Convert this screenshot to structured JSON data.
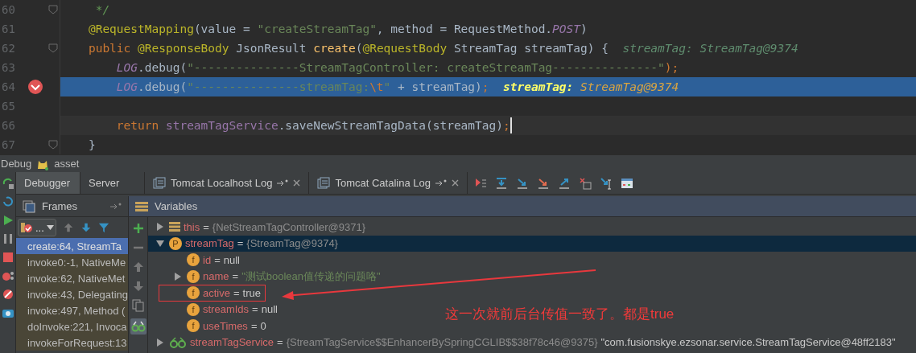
{
  "editor": {
    "lines": [
      {
        "number": "60",
        "fold": true,
        "breakpoint": false,
        "current": false,
        "caret": false,
        "tokens": [
          {
            "text": "     */",
            "kind": "comment"
          }
        ]
      },
      {
        "number": "61",
        "fold": false,
        "breakpoint": false,
        "current": false,
        "caret": false,
        "tokens": [
          {
            "text": "    @RequestMapping",
            "kind": "annotation"
          },
          {
            "text": "(value = ",
            "kind": "plain"
          },
          {
            "text": "\"createStreamTag\"",
            "kind": "string"
          },
          {
            "text": ", method = RequestMethod.",
            "kind": "plain"
          },
          {
            "text": "POST",
            "kind": "static"
          },
          {
            "text": ")",
            "kind": "plain"
          }
        ]
      },
      {
        "number": "62",
        "fold": true,
        "breakpoint": false,
        "current": false,
        "caret": false,
        "tokens": [
          {
            "text": "    public ",
            "kind": "keyword"
          },
          {
            "text": "@ResponseBody",
            "kind": "annotation"
          },
          {
            "text": " JsonResult ",
            "kind": "plain"
          },
          {
            "text": "create",
            "kind": "method"
          },
          {
            "text": "(",
            "kind": "plain"
          },
          {
            "text": "@RequestBody",
            "kind": "annotation"
          },
          {
            "text": " StreamTag streamTag) {  ",
            "kind": "plain"
          },
          {
            "text": "streamTag:",
            "kind": "hint-name"
          },
          {
            "text": " StreamTag@9374",
            "kind": "hint-value"
          }
        ]
      },
      {
        "number": "63",
        "fold": false,
        "breakpoint": false,
        "current": false,
        "caret": false,
        "tokens": [
          {
            "text": "        LOG",
            "kind": "static"
          },
          {
            "text": ".debug(",
            "kind": "plain"
          },
          {
            "text": "\"---------------StreamTagController: createStreamTag---------------\"",
            "kind": "string"
          },
          {
            "text": ");",
            "kind": "keyword"
          }
        ]
      },
      {
        "number": "64",
        "fold": false,
        "breakpoint": true,
        "current": true,
        "caret": false,
        "tokens": [
          {
            "text": "        LOG",
            "kind": "static"
          },
          {
            "text": ".debug(",
            "kind": "plain"
          },
          {
            "text": "\"---------------streamTag:",
            "kind": "string"
          },
          {
            "text": "\\t",
            "kind": "escape"
          },
          {
            "text": "\"",
            "kind": "string"
          },
          {
            "text": " + streamTag)",
            "kind": "plain"
          },
          {
            "text": ";  ",
            "kind": "keyword"
          },
          {
            "text": "streamTag:",
            "kind": "hint-name"
          },
          {
            "text": " StreamTag@9374",
            "kind": "hint-value"
          }
        ]
      },
      {
        "number": "65",
        "fold": false,
        "breakpoint": false,
        "current": false,
        "caret": false
      },
      {
        "number": "66",
        "fold": false,
        "breakpoint": false,
        "current": false,
        "caret": true,
        "tokens": [
          {
            "text": "        return ",
            "kind": "keyword"
          },
          {
            "text": "streamTagService",
            "kind": "field"
          },
          {
            "text": ".saveNewStreamTagData(streamTag)",
            "kind": "plain"
          },
          {
            "text": ";",
            "kind": "keyword"
          }
        ]
      },
      {
        "number": "67",
        "fold": true,
        "breakpoint": false,
        "current": false,
        "caret": false,
        "tokens": [
          {
            "text": "    }",
            "kind": "plain"
          }
        ]
      }
    ]
  },
  "debug_bar": {
    "title": "Debug",
    "config": "asset"
  },
  "tabs": [
    {
      "label": "Debugger",
      "selected": true,
      "kind": "plain"
    },
    {
      "label": "Server",
      "selected": false,
      "kind": "plain"
    },
    {
      "label": "Tomcat Localhost Log",
      "selected": false,
      "kind": "log"
    },
    {
      "label": "Tomcat Catalina Log",
      "selected": false,
      "kind": "log"
    }
  ],
  "frames": {
    "title": "Frames",
    "thread": "...",
    "items": [
      {
        "label": "create:64, StreamTa",
        "selected": true
      },
      {
        "label": "invoke0:-1, NativeMe",
        "selected": false
      },
      {
        "label": "invoke:62, NativeMet",
        "selected": false
      },
      {
        "label": "invoke:43, Delegating",
        "selected": false
      },
      {
        "label": "invoke:497, Method (",
        "selected": false
      },
      {
        "label": "doInvoke:221, Invoca",
        "selected": false
      },
      {
        "label": "invokeForRequest:13",
        "selected": false
      }
    ]
  },
  "variables": {
    "title": "Variables",
    "items": [
      {
        "name": "this",
        "sep": "=",
        "object_value": "{NetStreamTagController@9371}",
        "kind": "list",
        "expanded": false,
        "selected": false,
        "highlighted": false
      },
      {
        "name": "streamTag",
        "sep": "=",
        "object_value": "{StreamTag@9374}",
        "kind": "badge",
        "badge": "P",
        "expanded": true,
        "selected": true,
        "highlighted": false,
        "children": [
          {
            "name": "id",
            "sep": "=",
            "value": "null",
            "kind": "badge",
            "badge": "f",
            "selected": false,
            "highlighted": false
          },
          {
            "name": "name",
            "sep": "=",
            "string_value": "\"测试boolean值传递的问题咯\"",
            "kind": "badge",
            "badge": "f",
            "expanded": false,
            "selected": false,
            "highlighted": false
          },
          {
            "name": "active",
            "sep": "=",
            "value": "true",
            "kind": "badge",
            "badge": "f",
            "selected": false,
            "highlighted": true
          },
          {
            "name": "streamIds",
            "sep": "=",
            "value": "null",
            "kind": "badge",
            "badge": "f",
            "selected": false,
            "highlighted": false
          },
          {
            "name": "useTimes",
            "sep": "=",
            "value": "0",
            "kind": "badge",
            "badge": "f",
            "selected": false,
            "highlighted": false
          }
        ]
      },
      {
        "name": "streamTagService",
        "sep": "=",
        "object_value": "{StreamTagService$$EnhancerBySpringCGLIB$$38f78c46@9375}",
        "value": "\"com.fusionskye.ezsonar.service.StreamTagService@48ff2183\"",
        "kind": "watch",
        "expanded": false,
        "selected": false,
        "highlighted": false
      }
    ]
  },
  "annotation": {
    "note": "这一次就前后台传值一致了。都是true"
  }
}
